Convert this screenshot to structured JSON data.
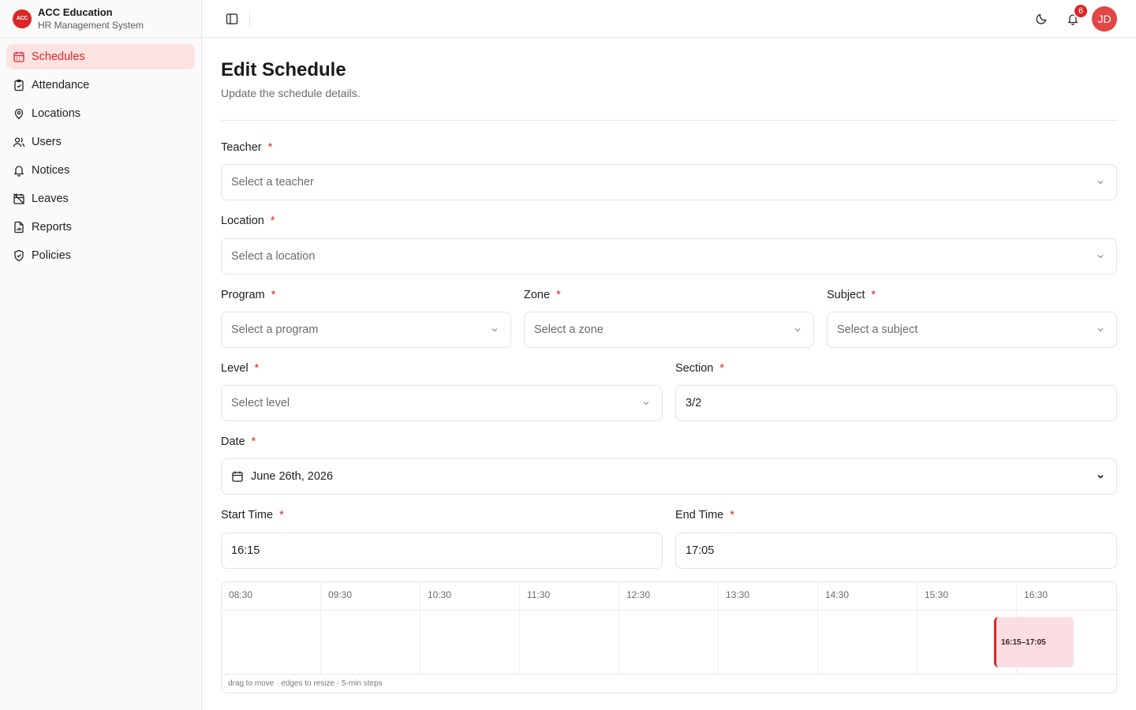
{
  "brand": {
    "logo_text": "ACC",
    "title": "ACC Education",
    "subtitle": "HR Management System"
  },
  "sidebar": {
    "items": [
      {
        "label": "Schedules",
        "icon": "calendar-icon",
        "active": true
      },
      {
        "label": "Attendance",
        "icon": "clipboard-check-icon",
        "active": false
      },
      {
        "label": "Locations",
        "icon": "map-pin-icon",
        "active": false
      },
      {
        "label": "Users",
        "icon": "users-icon",
        "active": false
      },
      {
        "label": "Notices",
        "icon": "bell-icon",
        "active": false
      },
      {
        "label": "Leaves",
        "icon": "calendar-off-icon",
        "active": false
      },
      {
        "label": "Reports",
        "icon": "file-chart-icon",
        "active": false
      },
      {
        "label": "Policies",
        "icon": "shield-check-icon",
        "active": false
      }
    ]
  },
  "topbar": {
    "notification_count": "6",
    "avatar_initials": "JD"
  },
  "page": {
    "title": "Edit Schedule",
    "subtitle": "Update the schedule details."
  },
  "form": {
    "required_mark": "*",
    "teacher": {
      "label": "Teacher",
      "placeholder": "Select a teacher"
    },
    "location": {
      "label": "Location",
      "placeholder": "Select a location"
    },
    "program": {
      "label": "Program",
      "placeholder": "Select a program"
    },
    "zone": {
      "label": "Zone",
      "placeholder": "Select a zone"
    },
    "subject": {
      "label": "Subject",
      "placeholder": "Select a subject"
    },
    "level": {
      "label": "Level",
      "placeholder": "Select level"
    },
    "section": {
      "label": "Section",
      "value": "3/2"
    },
    "date": {
      "label": "Date",
      "value": "June 26th, 2026"
    },
    "start_time": {
      "label": "Start Time",
      "value": "16:15"
    },
    "end_time": {
      "label": "End Time",
      "value": "17:05"
    }
  },
  "timeline": {
    "hours": [
      "08:30",
      "09:30",
      "10:30",
      "11:30",
      "12:30",
      "13:30",
      "14:30",
      "15:30",
      "16:30"
    ],
    "block_label": "16:15–17:05",
    "hint": "drag to move · edges to resize · 5-min steps"
  },
  "colors": {
    "accent": "#dc2626",
    "active_bg": "#fde2e2",
    "block_bg": "#fcdde3"
  }
}
